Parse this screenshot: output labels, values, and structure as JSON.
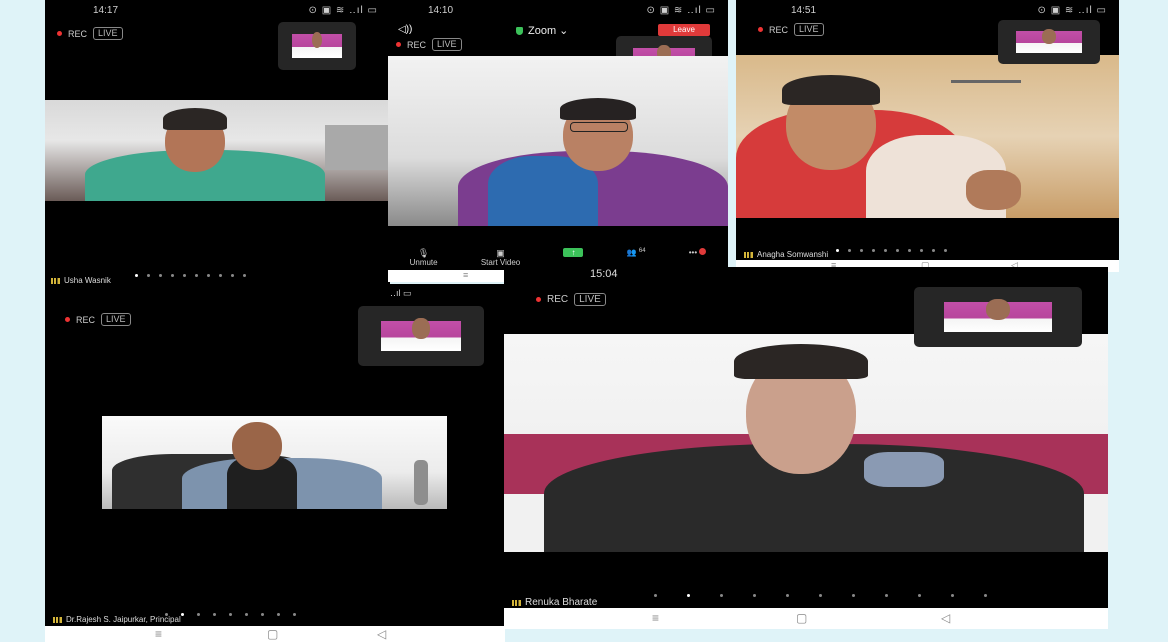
{
  "panels": {
    "p1": {
      "time": "14:17",
      "status_icons": "⊙ ▣ ≋ ‥ıl ▭",
      "rec": "REC",
      "live": "LIVE",
      "name": "Usha Wasnik"
    },
    "p2": {
      "time": "14:10",
      "audio_icon": "◁))",
      "app_title": "Zoom ⌄",
      "leave": "Leave",
      "rec": "REC",
      "live": "LIVE",
      "toolbar": [
        {
          "icon": "mic-off",
          "glyph": "🎙",
          "label": "Unmute"
        },
        {
          "icon": "video-off",
          "glyph": "▣",
          "label": "Start Video"
        },
        {
          "icon": "share",
          "glyph": "↑",
          "label": ""
        },
        {
          "icon": "participants",
          "glyph": "👥",
          "label": "",
          "count": "64"
        },
        {
          "icon": "more",
          "glyph": "•••",
          "label": ""
        }
      ]
    },
    "p3": {
      "time": "14:51",
      "status_icons": "⊙ ▣ ≋ ‥ıl ▭",
      "rec": "REC",
      "live": "LIVE",
      "name": "Anagha Somwanshi"
    },
    "p4": {
      "status_icons": "‥ıl ▭",
      "rec": "REC",
      "live": "LIVE",
      "name": "Dr.Rajesh S. Jaipurkar, Principal"
    },
    "p5": {
      "time": "15:04",
      "rec": "REC",
      "live": "LIVE",
      "name": "Renuka Bharate"
    }
  },
  "colors": {
    "bg": "#dff3f8",
    "rec": "#e33333",
    "leave": "#e03a3a",
    "shield": "#3cc25a",
    "pink": "#c24fa8"
  }
}
